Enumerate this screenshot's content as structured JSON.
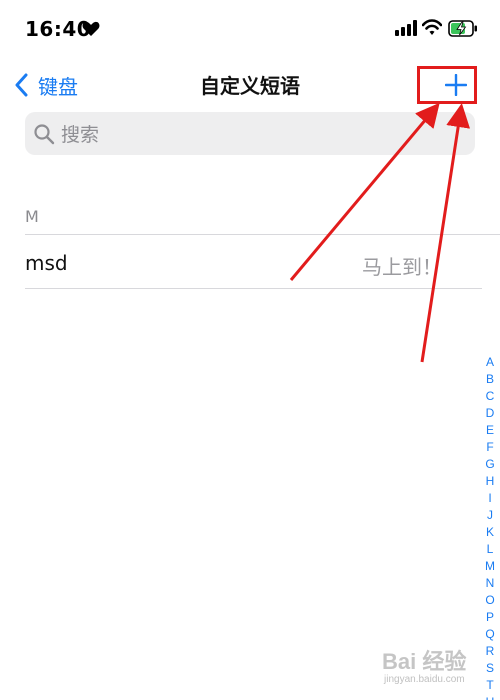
{
  "status_bar": {
    "time": "16:40",
    "icons": [
      "heart-icon",
      "cellular-signal-icon",
      "wifi-icon",
      "battery-charging-icon"
    ]
  },
  "nav": {
    "back_label": "键盘",
    "title": "自定义短语",
    "add_icon": "plus-icon"
  },
  "search": {
    "placeholder": "搜索",
    "icon": "search-icon"
  },
  "sections": [
    {
      "header": "M",
      "rows": [
        {
          "shortcut": "msd",
          "phrase": "马上到！"
        }
      ]
    }
  ],
  "index_letters": [
    "A",
    "B",
    "C",
    "D",
    "E",
    "F",
    "G",
    "H",
    "I",
    "J",
    "K",
    "L",
    "M",
    "N",
    "O",
    "P",
    "Q",
    "R",
    "S",
    "T",
    "U"
  ],
  "watermark": {
    "brand": "Bai 经验",
    "url": "jingyan.baidu.com"
  },
  "colors": {
    "accent": "#1a7cf2",
    "annotation": "#e21c1c",
    "search_bg": "#eeeeef",
    "secondary_text": "#8e8e93"
  }
}
